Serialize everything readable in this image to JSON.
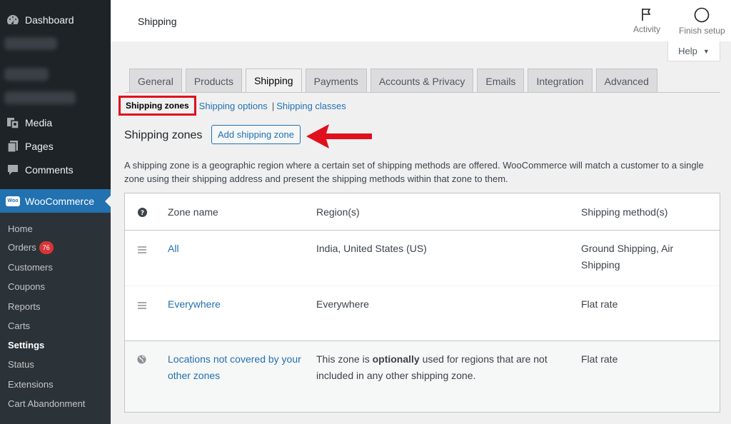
{
  "sidebar": {
    "dashboard": "Dashboard",
    "media": "Media",
    "pages": "Pages",
    "comments": "Comments",
    "woocommerce": "WooCommerce",
    "woo_badge": "Woo",
    "submenu": {
      "home": "Home",
      "orders": "Orders",
      "orders_count": "76",
      "customers": "Customers",
      "coupons": "Coupons",
      "reports": "Reports",
      "carts": "Carts",
      "settings": "Settings",
      "status": "Status",
      "extensions": "Extensions",
      "cart_abandonment": "Cart Abandonment"
    }
  },
  "header": {
    "title": "Shipping",
    "activity": "Activity",
    "finish_setup": "Finish setup",
    "help": "Help"
  },
  "tabs": [
    {
      "label": "General"
    },
    {
      "label": "Products"
    },
    {
      "label": "Shipping"
    },
    {
      "label": "Payments"
    },
    {
      "label": "Accounts & Privacy"
    },
    {
      "label": "Emails"
    },
    {
      "label": "Integration"
    },
    {
      "label": "Advanced"
    }
  ],
  "subnav": {
    "current": "Shipping zones",
    "options": "Shipping options",
    "separator": "|",
    "classes": "Shipping classes"
  },
  "section": {
    "title": "Shipping zones",
    "add_button": "Add shipping zone",
    "description": "A shipping zone is a geographic region where a certain set of shipping methods are offered. WooCommerce will match a customer to a single zone using their shipping address and present the shipping methods within that zone to them."
  },
  "table": {
    "columns": {
      "zone_name": "Zone name",
      "regions": "Region(s)",
      "methods": "Shipping method(s)"
    },
    "rows": [
      {
        "zone": "All",
        "region": "India, United States (US)",
        "method": "Ground Shipping, Air Shipping"
      },
      {
        "zone": "Everywhere",
        "region": "Everywhere",
        "method": "Flat rate"
      }
    ],
    "fallback": {
      "zone": "Locations not covered by your other zones",
      "region_pre": "This zone is ",
      "region_bold": "optionally",
      "region_post": " used for regions that are not included in any other shipping zone.",
      "method": "Flat rate"
    }
  },
  "colors": {
    "sidebar_bg": "#1d2327",
    "accent": "#2271b1",
    "highlight_red": "#e0101c",
    "badge_red": "#d63638"
  }
}
